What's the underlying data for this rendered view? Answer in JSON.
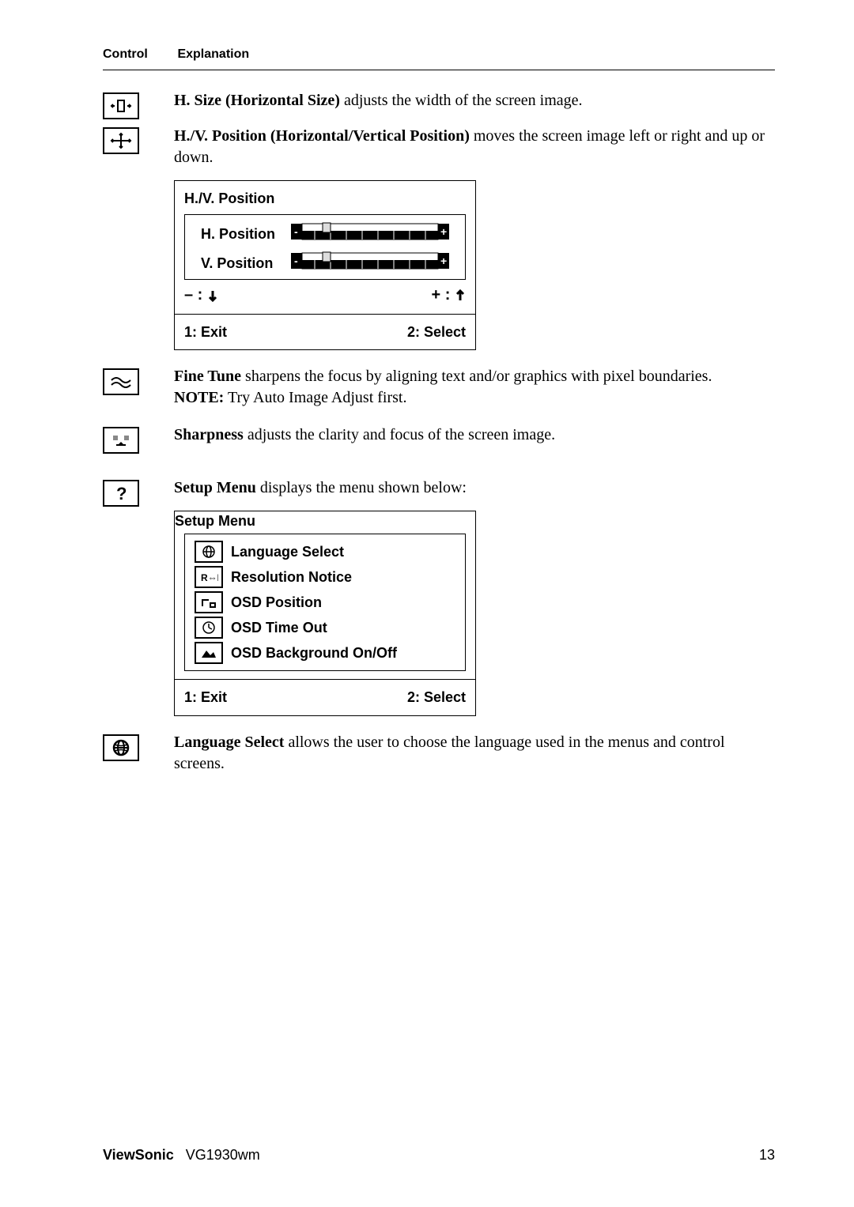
{
  "header": {
    "control": "Control",
    "explanation": "Explanation"
  },
  "hsize": {
    "bold": "H. Size (Horizontal Size)",
    "text": " adjusts the width of the screen image."
  },
  "hvpos": {
    "bold": "H./V. Position (Horizontal/Vertical Position)",
    "text": " moves the screen image left or right and up or down."
  },
  "hvpanel": {
    "title": "H./V. Position",
    "hpos": "H. Position",
    "vpos": "V. Position",
    "minus": "– :",
    "plus": "+ :",
    "exit": "1: Exit",
    "select": "2: Select"
  },
  "finetune": {
    "bold": "Fine Tune",
    "text": " sharpens the focus by aligning text and/or graphics with pixel boundaries.",
    "notebold": "NOTE:",
    "note": " Try Auto Image Adjust first."
  },
  "sharpness": {
    "bold": "Sharpness",
    "text": " adjusts the clarity and focus of the screen image."
  },
  "setup": {
    "bold": "Setup Menu",
    "text": " displays the menu shown below:"
  },
  "setuppanel": {
    "title": "Setup Menu",
    "lang": "Language Select",
    "res": "Resolution Notice",
    "pos": "OSD Position",
    "timeout": "OSD Time Out",
    "bg": "OSD Background On/Off",
    "exit": "1: Exit",
    "select": "2: Select"
  },
  "langselect": {
    "bold": "Language Select",
    "text": " allows the user to choose the language used in the menus and control screens."
  },
  "footer": {
    "brand": "ViewSonic",
    "model": "VG1930wm",
    "page": "13"
  }
}
